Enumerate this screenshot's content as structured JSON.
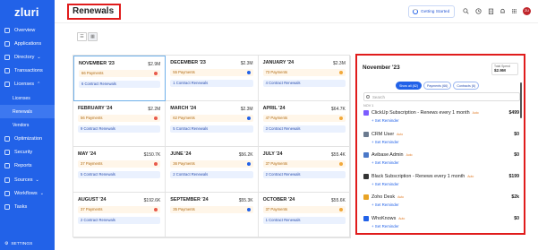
{
  "app": {
    "logo": "zluri",
    "title": "Renewals",
    "getting_started": "Getting Started",
    "avatar_initials": "ZU"
  },
  "sidebar": {
    "items": [
      {
        "label": "Overview",
        "icon": "grid-icon"
      },
      {
        "label": "Applications",
        "icon": "apps-icon"
      },
      {
        "label": "Directory",
        "icon": "directory-icon",
        "chevron": "⌄"
      },
      {
        "label": "Transactions",
        "icon": "transactions-icon"
      },
      {
        "label": "Licenses",
        "icon": "licenses-icon",
        "chevron": "⌃"
      },
      {
        "label": "Licenses",
        "icon": "sub-dot-icon",
        "sub": true
      },
      {
        "label": "Renewals",
        "icon": "sub-dot-icon",
        "sub": true,
        "active": true
      },
      {
        "label": "Vendors",
        "icon": "sub-dot-icon",
        "sub": true
      },
      {
        "label": "Optimization",
        "icon": "optimization-icon"
      },
      {
        "label": "Security",
        "icon": "security-icon"
      },
      {
        "label": "Reports",
        "icon": "reports-icon"
      },
      {
        "label": "Sources",
        "icon": "sources-icon",
        "chevron": "⌄"
      },
      {
        "label": "Workflows",
        "icon": "workflows-icon",
        "chevron": "⌄"
      },
      {
        "label": "Tasks",
        "icon": "tasks-icon"
      }
    ],
    "settings": "SETTINGS"
  },
  "calendar": {
    "months": [
      {
        "month": "NOVEMBER '23",
        "amount": "$2.9M",
        "payments": "66 Payments",
        "contracts": "6 Contract Renewals",
        "selected": true
      },
      {
        "month": "DECEMBER '23",
        "amount": "$2.3M",
        "payments": "55 Payments",
        "contracts": "1 Contract Renewals"
      },
      {
        "month": "JANUARY '24",
        "amount": "$2.3M",
        "payments": "73 Payments",
        "contracts": "4 Contract Renewals"
      },
      {
        "month": "FEBRUARY '24",
        "amount": "$2.2M",
        "payments": "56 Payments",
        "contracts": "9 Contract Renewals"
      },
      {
        "month": "MARCH '24",
        "amount": "$2.3M",
        "payments": "62 Payments",
        "contracts": "5 Contract Renewals"
      },
      {
        "month": "APRIL '24",
        "amount": "$64.7K",
        "payments": "47 Payments",
        "contracts": "3 Contract Renewals"
      },
      {
        "month": "MAY '24",
        "amount": "$150.7K",
        "payments": "37 Payments",
        "contracts": "5 Contract Renewals"
      },
      {
        "month": "JUNE '24",
        "amount": "$56.2K",
        "payments": "36 Payments",
        "contracts": "2 Contract Renewals"
      },
      {
        "month": "JULY '24",
        "amount": "$55.4K",
        "payments": "37 Payments",
        "contracts": "2 Contract Renewals"
      },
      {
        "month": "AUGUST '24",
        "amount": "$192.6K",
        "payments": "37 Payments",
        "contracts": "2 Contract Renewals"
      },
      {
        "month": "SEPTEMBER '24",
        "amount": "$55.3K",
        "payments": "35 Payments",
        "contracts": ""
      },
      {
        "month": "OCTOBER '24",
        "amount": "$55.6K",
        "payments": "37 Payments",
        "contracts": "1 Contract Renewals"
      }
    ]
  },
  "panel": {
    "title": "November '23",
    "total_label": "Total Spend",
    "total_value": "$2.9M",
    "chips": [
      "Show all (82)",
      "Payments (66)",
      "Contracts (6)"
    ],
    "search_placeholder": "Search",
    "group_label": "NOV 1",
    "items": [
      {
        "name": "ClickUp Subscription - Renews every 1 month",
        "tag": "Auto",
        "price": "$499",
        "reminder": "+ Set Reminder",
        "color": "#7b5cff"
      },
      {
        "name": "CRM User",
        "tag": "Auto",
        "price": "$0",
        "reminder": "+ Set Reminder",
        "color": "#6b7a8f"
      },
      {
        "name": "Avibase Admin",
        "tag": "Auto",
        "price": "$0",
        "reminder": "+ Set Reminder",
        "color": "#4a78c8"
      },
      {
        "name": "Black Subscription - Renews every 1 month",
        "tag": "Auto",
        "price": "$199",
        "reminder": "+ Set Reminder",
        "color": "#333333"
      },
      {
        "name": "Zoho Desk",
        "tag": "Auto",
        "price": "$2k",
        "reminder": "+ Set Reminder",
        "color": "#e8a325"
      },
      {
        "name": "WhoKnows",
        "tag": "Auto",
        "price": "$0",
        "reminder": "+ Set Reminder",
        "color": "#2262e8"
      }
    ]
  }
}
